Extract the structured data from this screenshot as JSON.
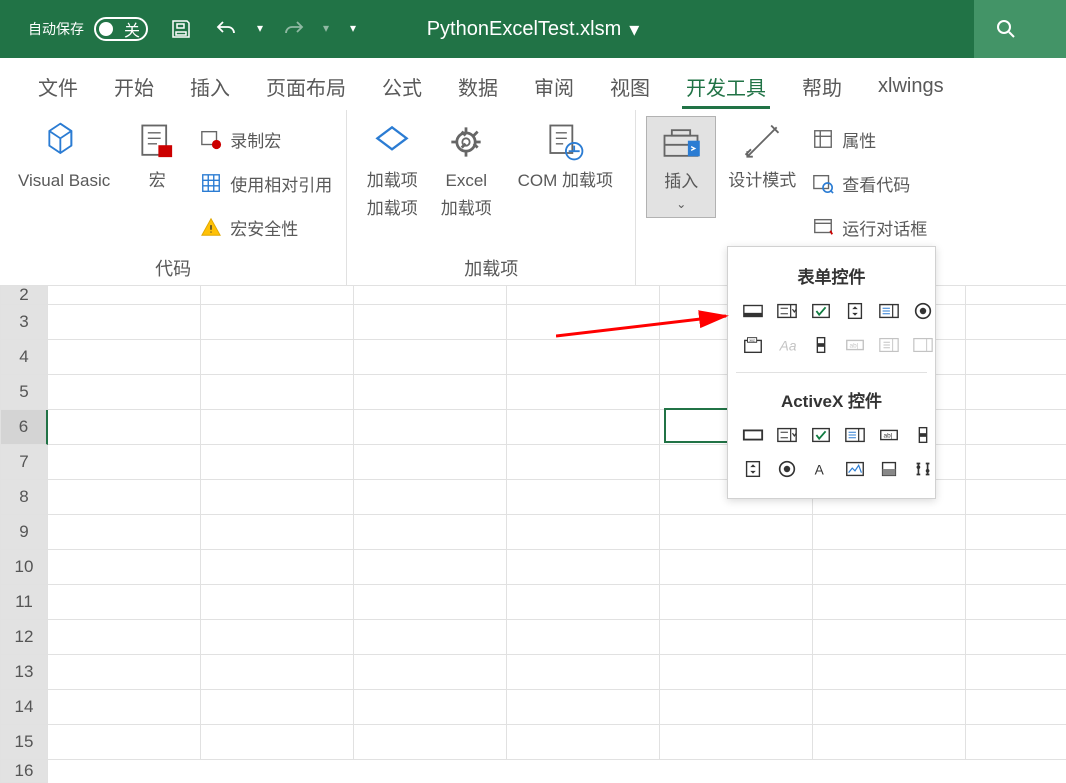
{
  "titlebar": {
    "autosave_label": "自动保存",
    "autosave_off": "关",
    "filename": "PythonExcelTest.xlsm"
  },
  "tabs": {
    "items": [
      {
        "label": "文件"
      },
      {
        "label": "开始"
      },
      {
        "label": "插入"
      },
      {
        "label": "页面布局"
      },
      {
        "label": "公式"
      },
      {
        "label": "数据"
      },
      {
        "label": "审阅"
      },
      {
        "label": "视图"
      },
      {
        "label": "开发工具"
      },
      {
        "label": "帮助"
      },
      {
        "label": "xlwings"
      }
    ]
  },
  "ribbon": {
    "group1": {
      "visual_basic": "Visual Basic",
      "macros": "宏",
      "record_macro": "录制宏",
      "use_relative": "使用相对引用",
      "macro_security": "宏安全性",
      "label": "代码"
    },
    "group2": {
      "addins": "加载项",
      "addins_line2": "",
      "excel_addins": "Excel",
      "excel_addins_line2": "加载项",
      "com_addins": "COM 加载项",
      "label": "加载项"
    },
    "group3": {
      "insert": "插入",
      "design_mode": "设计模式",
      "properties": "属性",
      "view_code": "查看代码",
      "run_dialog": "运行对话框"
    }
  },
  "insert_panel": {
    "form_controls_title": "表单控件",
    "activex_controls_title": "ActiveX 控件"
  },
  "rows": [
    "2",
    "3",
    "4",
    "5",
    "6",
    "7",
    "8",
    "9",
    "10",
    "11",
    "12",
    "13",
    "14",
    "15",
    "16"
  ]
}
